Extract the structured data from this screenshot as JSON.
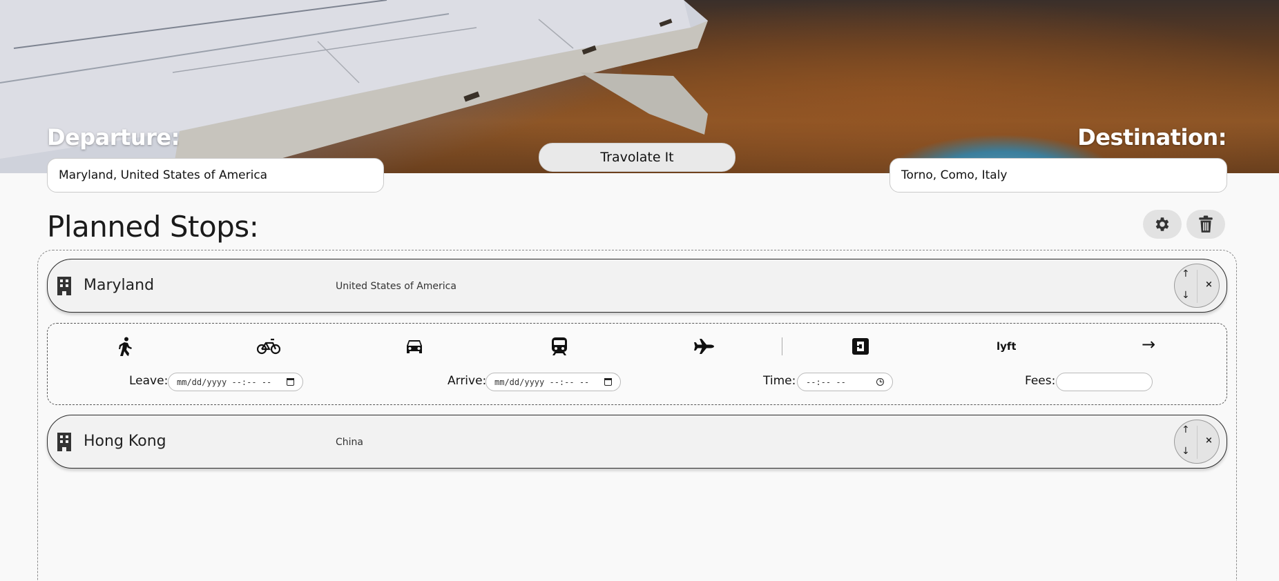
{
  "hero": {
    "departure_label": "Departure:",
    "destination_label": "Destination:",
    "departure_value": "Maryland, United States of America",
    "destination_value": "Torno, Como, Italy",
    "go_button": "Travolate It"
  },
  "planner": {
    "title": "Planned Stops:",
    "settings_icon": "gear-icon",
    "trash_icon": "trash-icon"
  },
  "stops": [
    {
      "name": "Maryland",
      "country": "United States of America",
      "icon": "building-icon"
    },
    {
      "name": "Hong Kong",
      "country": "China",
      "icon": "building-icon"
    }
  ],
  "stop_controls": {
    "up": "↑",
    "down": "↓",
    "remove": "×"
  },
  "transport": {
    "modes": [
      "walk-icon",
      "bicycle-icon",
      "car-icon",
      "train-icon",
      "plane-icon",
      "uber-icon",
      "lyft-icon"
    ],
    "next": "→",
    "leave_label": "Leave:",
    "arrive_label": "Arrive:",
    "time_label": "Time:",
    "fees_label": "Fees:",
    "datetime_placeholder": "mm/dd/yyyy --:-- --",
    "time_placeholder": "--:-- --",
    "fees_value": ""
  },
  "colors": {
    "page_bg": "#f9f9f9",
    "card_bg": "#f2f2f2",
    "button_bg": "#e9e9e9"
  }
}
